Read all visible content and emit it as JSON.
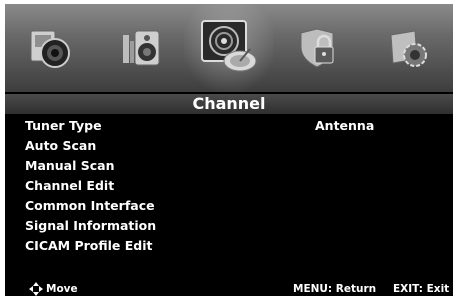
{
  "osd": {
    "icons": [
      {
        "name": "picture-icon",
        "selected": false
      },
      {
        "name": "sound-icon",
        "selected": false
      },
      {
        "name": "channel-icon",
        "selected": true
      },
      {
        "name": "lock-icon",
        "selected": false
      },
      {
        "name": "setup-icon",
        "selected": false
      }
    ],
    "title": "Channel",
    "items": [
      {
        "label": "Tuner Type",
        "value": "Antenna"
      },
      {
        "label": "Auto Scan"
      },
      {
        "label": "Manual Scan"
      },
      {
        "label": "Channel Edit"
      },
      {
        "label": "Common Interface"
      },
      {
        "label": "Signal Information"
      },
      {
        "label": "CICAM Profile Edit"
      }
    ],
    "footer": {
      "move": "Move",
      "return": "MENU: Return",
      "exit": "EXIT: Exit"
    },
    "colors": {
      "background": "#000000",
      "text": "#ffffff",
      "title_bar": "#3a3a3a"
    }
  }
}
